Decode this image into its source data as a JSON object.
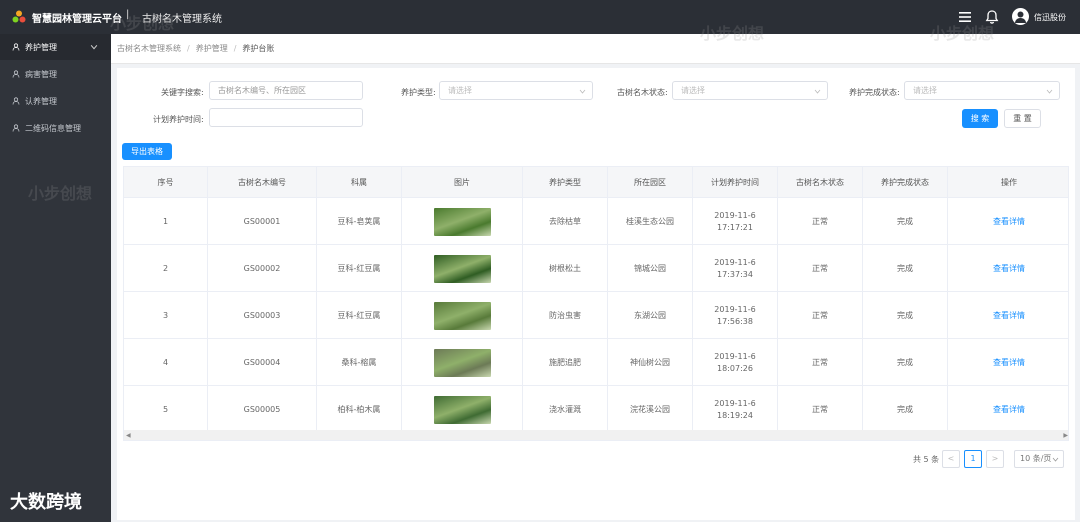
{
  "header": {
    "app_title": "智慧园林管理云平台",
    "separator": "|",
    "system_title": "古树名木管理系统",
    "user_name": "信迅股份"
  },
  "sidebar": {
    "items": [
      {
        "label": "养护管理",
        "active": true
      },
      {
        "label": "病害管理",
        "active": false
      },
      {
        "label": "认养管理",
        "active": false
      },
      {
        "label": "二维码信息管理",
        "active": false
      }
    ]
  },
  "breadcrumb": {
    "items": [
      "古树名木管理系统",
      "养护管理",
      "养护台账"
    ],
    "separator": "/"
  },
  "filters": {
    "keyword_label": "关键字搜索:",
    "keyword_placeholder": "古树名木编号、所在园区",
    "type_label": "养护类型:",
    "type_placeholder": "请选择",
    "status_label": "古树名木状态:",
    "status_placeholder": "请选择",
    "complete_label": "养护完成状态:",
    "complete_placeholder": "请选择",
    "time_label": "计划养护时间:",
    "time_value": ""
  },
  "buttons": {
    "search": "搜 索",
    "reset": "重 置",
    "export": "导出表格"
  },
  "table": {
    "columns": [
      "序号",
      "古树名木编号",
      "科属",
      "图片",
      "养护类型",
      "所在园区",
      "计划养护时间",
      "古树名木状态",
      "养护完成状态",
      "操作"
    ],
    "rows": [
      {
        "no": "1",
        "code": "GS00001",
        "family": "豆科-皂荚属",
        "type": "去除枯草",
        "park": "桂溪生态公园",
        "date": "2019-11-6",
        "time": "17:17:21",
        "state": "正常",
        "done": "完成",
        "action": "查看详情",
        "img_color": "#4a7a2e"
      },
      {
        "no": "2",
        "code": "GS00002",
        "family": "豆科-红豆属",
        "type": "树根松土",
        "park": "锦城公园",
        "date": "2019-11-6",
        "time": "17:37:34",
        "state": "正常",
        "done": "完成",
        "action": "查看详情",
        "img_color": "#2f5d23"
      },
      {
        "no": "3",
        "code": "GS00003",
        "family": "豆科-红豆属",
        "type": "防治虫害",
        "park": "东湖公园",
        "date": "2019-11-6",
        "time": "17:56:38",
        "state": "正常",
        "done": "完成",
        "action": "查看详情",
        "img_color": "#587a3a"
      },
      {
        "no": "4",
        "code": "GS00004",
        "family": "桑科-榕属",
        "type": "施肥追肥",
        "park": "神仙树公园",
        "date": "2019-11-6",
        "time": "18:07:26",
        "state": "正常",
        "done": "完成",
        "action": "查看详情",
        "img_color": "#6c7a56"
      },
      {
        "no": "5",
        "code": "GS00005",
        "family": "柏科-柏木属",
        "type": "浇水灌溉",
        "park": "浣花溪公园",
        "date": "2019-11-6",
        "time": "18:19:24",
        "state": "正常",
        "done": "完成",
        "action": "查看详情",
        "img_color": "#3f6b33"
      }
    ]
  },
  "pagination": {
    "total": "共 5 条",
    "prev": "<",
    "current": "1",
    "next": ">",
    "page_size": "10 条/页"
  },
  "watermarks": {
    "text": "小步创想",
    "brand": "大数跨境"
  },
  "colors": {
    "accent": "#1890ff",
    "topbar": "#2b2f36",
    "sidebar": "#30343b"
  }
}
